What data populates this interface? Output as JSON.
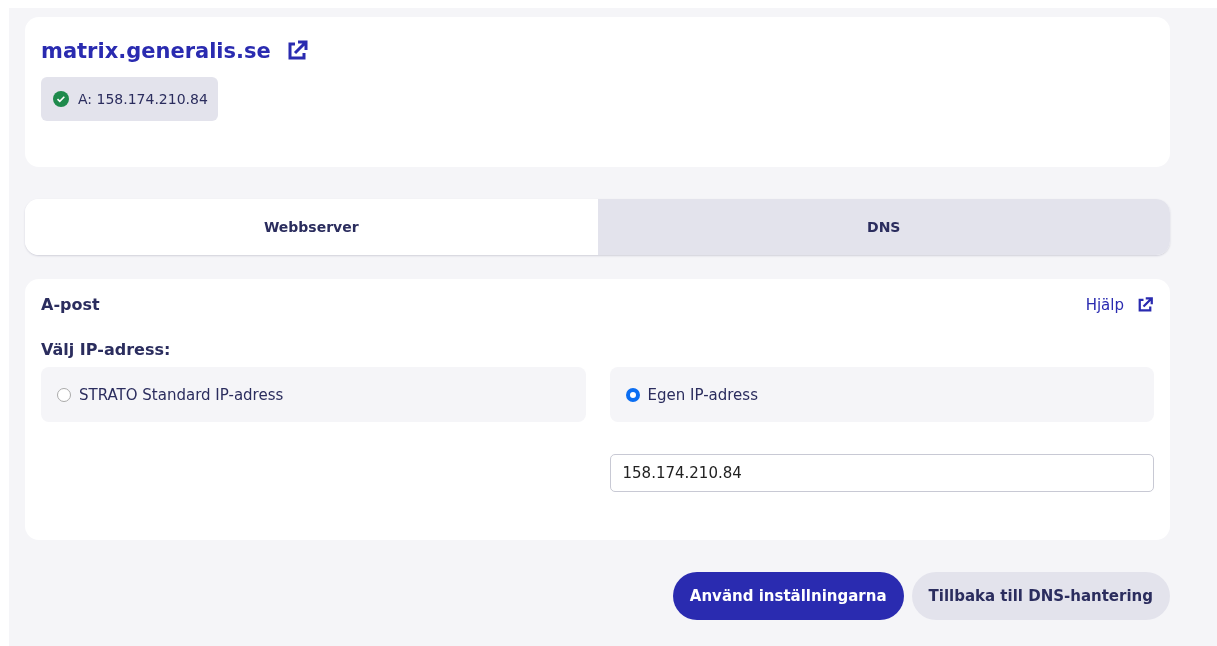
{
  "domain": {
    "name": "matrix.generalis.se",
    "records": [
      {
        "text": "A: 158.174.210.84",
        "verified": true
      }
    ]
  },
  "tabs": [
    {
      "label": "Webbserver",
      "selected": false
    },
    {
      "label": "DNS",
      "selected": true
    }
  ],
  "record": {
    "title": "A-post",
    "help": "Hjälp",
    "prompt": "Välj IP-adress:",
    "options": [
      {
        "label": "STRATO Standard IP-adress",
        "selected": false
      },
      {
        "label": "Egen IP-adress",
        "selected": true
      }
    ],
    "ip_field": {
      "value": "158.174.210.84"
    }
  },
  "buttons": [
    {
      "label": "Använd inställningarna",
      "kind": "primary"
    },
    {
      "label": "Tillbaka till DNS-hantering",
      "kind": "secondary"
    }
  ]
}
